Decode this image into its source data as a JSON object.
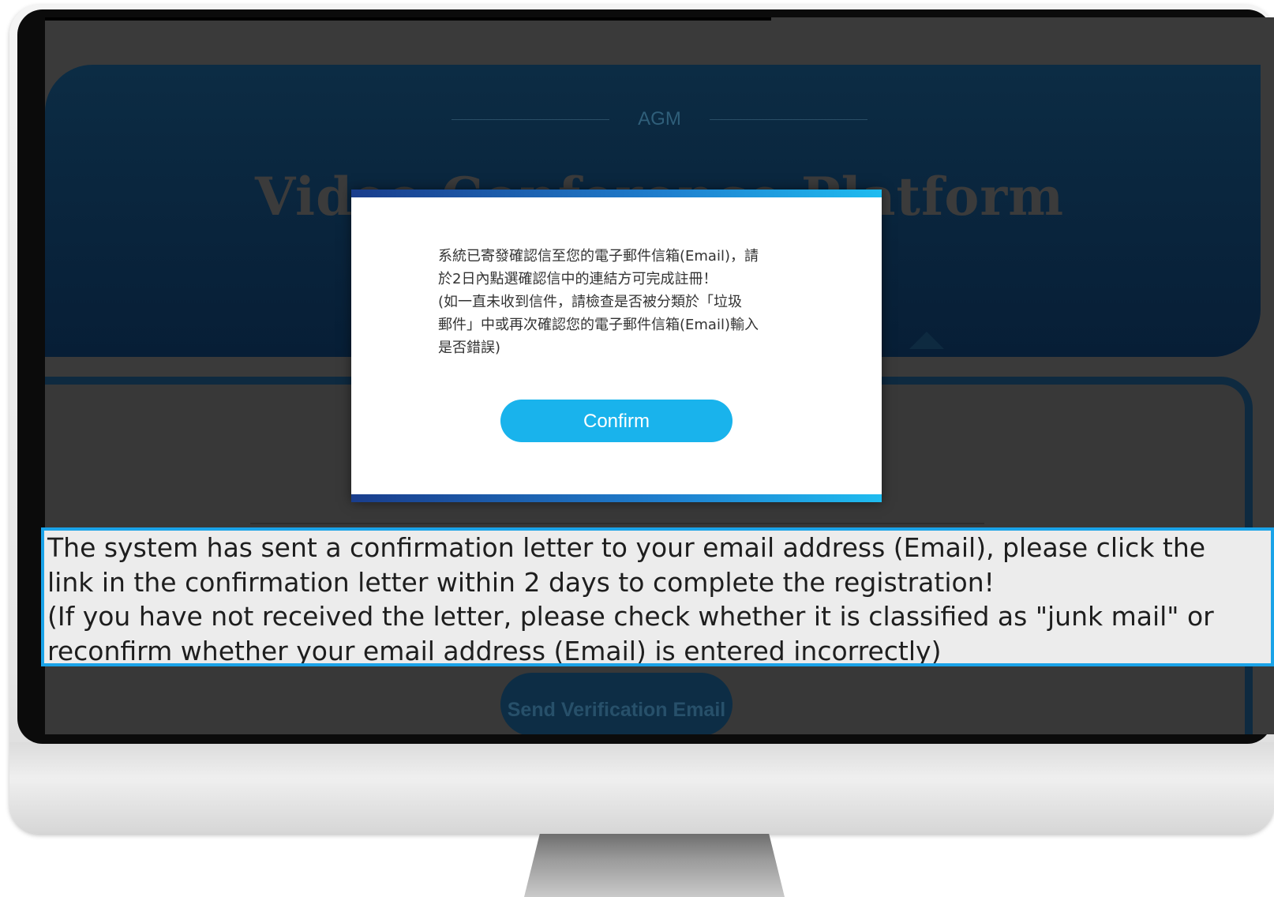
{
  "page": {
    "agm_label": "AGM",
    "title": "Video Conference Platform",
    "send_button_label": "Send Verification Email"
  },
  "dialog": {
    "message": "系統已寄發確認信至您的電子郵件信箱(Email)，請\n於2日內點選確認信中的連結方可完成註冊！\n(如一直未收到信件，請檢查是否被分類於「垃圾\n郵件」中或再次確認您的電子郵件信箱(Email)輸入\n是否錯誤)",
    "confirm_label": "Confirm"
  },
  "caption": {
    "text": "The system has sent a confirmation letter to your email address (Email), please click the\nlink in the confirmation letter within 2 days to complete the registration!\n (If you have not received the letter, please check whether it is classified as \"junk mail\" or\nreconfirm whether your email address (Email) is entered incorrectly)"
  },
  "colors": {
    "accent": "#19b3ec",
    "caption_border": "#1aa3e8",
    "hero_bg": "#0c2c44"
  }
}
